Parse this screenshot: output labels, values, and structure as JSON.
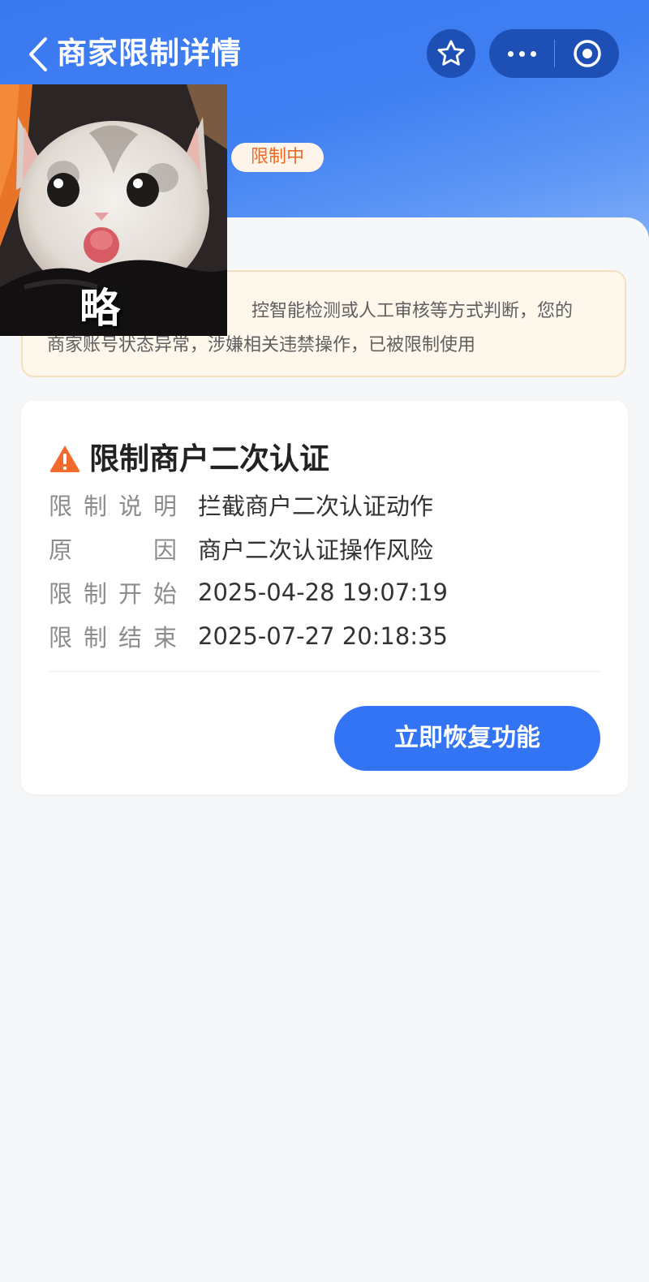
{
  "nav": {
    "title": "商家限制详情"
  },
  "status": {
    "badge": "限制中"
  },
  "notice": {
    "line1": "控智能检测或人工审核等方式判断，您的",
    "line2": "商家账号状态异常，涉嫌相关违禁操作，已被限制使用"
  },
  "sticker": {
    "text": "略"
  },
  "restriction": {
    "title": "限制商户二次认证",
    "rows": [
      {
        "label": [
          "限",
          "制",
          "说",
          "明"
        ],
        "value": "拦截商户二次认证动作"
      },
      {
        "label": [
          "原",
          "因"
        ],
        "value": "商户二次认证操作风险"
      },
      {
        "label": [
          "限",
          "制",
          "开",
          "始"
        ],
        "value": "2025-04-28 19:07:19"
      },
      {
        "label": [
          "限",
          "制",
          "结",
          "束"
        ],
        "value": "2025-07-27 20:18:35"
      }
    ],
    "button": "立即恢复功能"
  },
  "colors": {
    "accent": "#3374f4",
    "header": "#3f7ff2",
    "badge_text": "#f06a23",
    "warning": "#f26a2e"
  }
}
